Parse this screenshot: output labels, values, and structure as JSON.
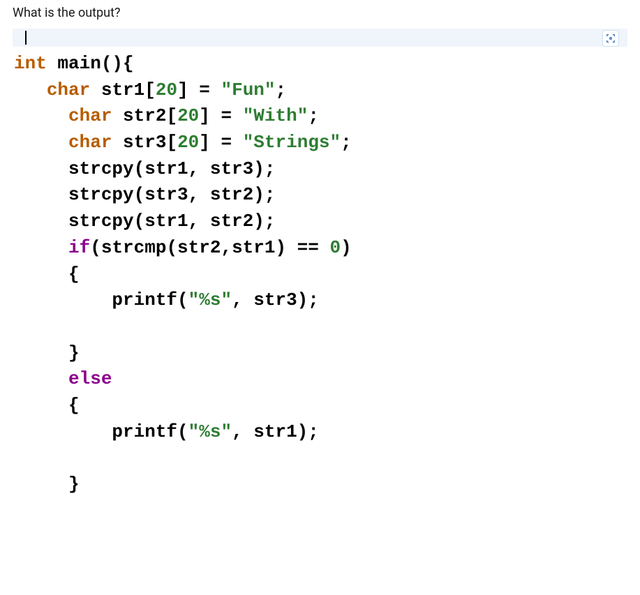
{
  "question": "What is the output?",
  "icon": {
    "name": "scan-icon"
  },
  "code": {
    "l1": {
      "t1": "int",
      "t2": " main(){"
    },
    "l2": {
      "t1": "   ",
      "t2": "char",
      "t3": " str1[",
      "t4": "20",
      "t5": "] = ",
      "t6": "\"Fun\"",
      "t7": ";"
    },
    "l3": {
      "t1": "     ",
      "t2": "char",
      "t3": " str2[",
      "t4": "20",
      "t5": "] = ",
      "t6": "\"With\"",
      "t7": ";"
    },
    "l4": {
      "t1": "     ",
      "t2": "char",
      "t3": " str3[",
      "t4": "20",
      "t5": "] = ",
      "t6": "\"Strings\"",
      "t7": ";"
    },
    "l5": {
      "t1": "     strcpy(str1, str3);"
    },
    "l6": {
      "t1": "     strcpy(str3, str2);"
    },
    "l7": {
      "t1": "     strcpy(str1, str2);"
    },
    "l8": {
      "t1": "     ",
      "t2": "if",
      "t3": "(strcmp(str2,str1) == ",
      "t4": "0",
      "t5": ")"
    },
    "l9": {
      "t1": "     {"
    },
    "l10": {
      "t1": "         printf(",
      "t2": "\"%s\"",
      "t3": ", str3);"
    },
    "l11": {
      "t1": ""
    },
    "l12": {
      "t1": "     }"
    },
    "l13": {
      "t1": "     ",
      "t2": "else"
    },
    "l14": {
      "t1": "     {"
    },
    "l15": {
      "t1": "         printf(",
      "t2": "\"%s\"",
      "t3": ", str1);"
    },
    "l16": {
      "t1": ""
    },
    "l17": {
      "t1": "     }"
    }
  }
}
